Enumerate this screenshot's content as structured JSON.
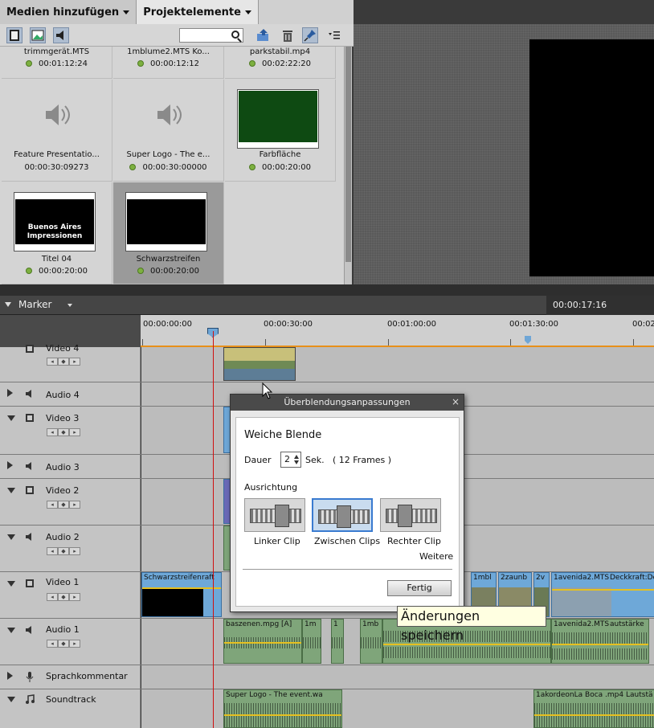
{
  "tabs": [
    {
      "label": "Medien hinzufügen"
    },
    {
      "label": "Projektelemente"
    }
  ],
  "media": [
    {
      "name": "trimmgerät.MTS",
      "duration": "00:01:12:24"
    },
    {
      "name": "1mblume2.MTS Ko...",
      "duration": "00:00:12:12"
    },
    {
      "name": "parkstabil.mp4",
      "duration": "00:02:22:20"
    },
    {
      "name": "Feature Presentatio...",
      "duration": "00:00:30:09273"
    },
    {
      "name": "Super Logo - The e...",
      "duration": "00:00:30:00000"
    },
    {
      "name": "Farbfläche",
      "duration": "00:00:20:00"
    },
    {
      "name": "Titel 04",
      "duration": "00:00:20:00",
      "thumb_text": "Buenos Aires Impressionen"
    },
    {
      "name": "Schwarzstreifen",
      "duration": "00:00:20:00"
    }
  ],
  "marker": {
    "label": "Marker",
    "timecode": "00:00:17:16"
  },
  "ruler": {
    "labels": [
      "00:00:00:00",
      "00:00:30:00",
      "00:01:00:00",
      "00:01:30:00",
      "00:02"
    ]
  },
  "tracks": [
    {
      "name": "Video 4"
    },
    {
      "name": "Audio 4"
    },
    {
      "name": "Video 3"
    },
    {
      "name": "Audio 3"
    },
    {
      "name": "Video 2"
    },
    {
      "name": "Audio 2"
    },
    {
      "name": "Video 1"
    },
    {
      "name": "Audio 1"
    },
    {
      "name": "Sprachkommentar"
    },
    {
      "name": "Soundtrack"
    }
  ],
  "clips": {
    "v1_a": "Schwarzstreifen",
    "v1_a2": "raft",
    "v1_b": "1mbl",
    "v1_c": "2zaunb",
    "v1_d": "2v",
    "v1_e": "1avenida2.MTS",
    "v1_f": "Deckkraft:Dec",
    "a1_a": "baszenen.mpg [A]",
    "a1_b": "1m",
    "a1_c": "1",
    "a1_d": "1mb",
    "a1_e": "1avenida2.MTS",
    "a1_f": "autstärke",
    "st_a": "Super Logo - The event.wa",
    "st_b": "1akordeonLa Boca .mp4",
    "st_c": "Lautstä"
  },
  "dialog": {
    "title": "Überblendungsanpassungen",
    "heading": "Weiche Blende",
    "dauer_label": "Dauer",
    "dauer_value": "2",
    "unit": "Sek.",
    "frames": "( 12 Frames )",
    "ausrichtung": "Ausrichtung",
    "opt_left": "Linker Clip",
    "opt_mid": "Zwischen Clips",
    "opt_right": "Rechter Clip",
    "weitere": "Weitere",
    "fertig": "Fertig"
  },
  "tooltip": "Änderungen speichern",
  "colors": {
    "accent": "#3a7bd0",
    "playhead": "#d01010",
    "ruler_line": "#e8901a"
  }
}
